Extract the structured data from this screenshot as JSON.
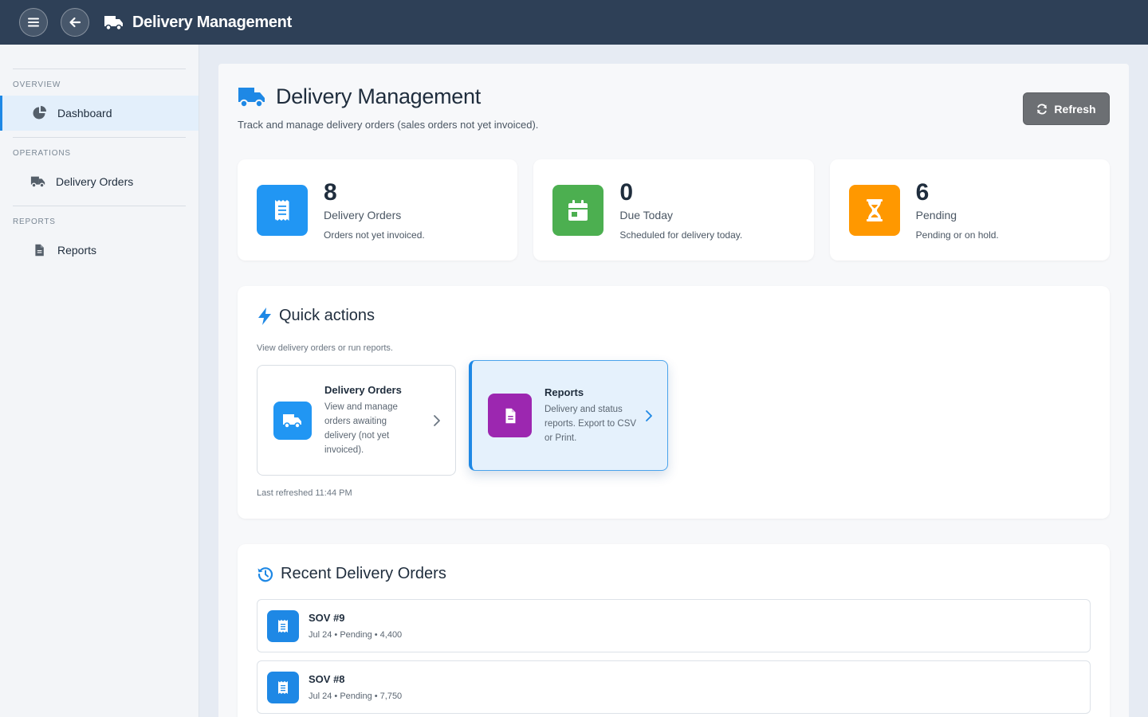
{
  "topbar": {
    "title": "Delivery Management"
  },
  "sidebar": {
    "sections": [
      {
        "heading": "OVERVIEW",
        "item": "Dashboard"
      },
      {
        "heading": "OPERATIONS",
        "item": "Delivery Orders"
      },
      {
        "heading": "REPORTS",
        "item": "Reports"
      }
    ]
  },
  "page": {
    "title": "Delivery Management",
    "subtitle": "Track and manage delivery orders (sales orders not yet invoiced).",
    "refresh_label": "Refresh"
  },
  "stats": [
    {
      "value": "8",
      "label": "Delivery Orders",
      "desc": "Orders not yet invoiced.",
      "color": "#2196f3",
      "icon": "receipt-icon"
    },
    {
      "value": "0",
      "label": "Due Today",
      "desc": "Scheduled for delivery today.",
      "color": "#4caf50",
      "icon": "calendar-icon"
    },
    {
      "value": "6",
      "label": "Pending",
      "desc": "Pending or on hold.",
      "color": "#ff9800",
      "icon": "hourglass-icon"
    }
  ],
  "quick_actions": {
    "title": "Quick actions",
    "subtitle": "View delivery orders or run reports.",
    "tiles": [
      {
        "name": "Delivery Orders",
        "desc": "View and manage orders awaiting delivery (not yet invoiced).",
        "color": "#2196f3",
        "icon": "truck-icon"
      },
      {
        "name": "Reports",
        "desc": "Delivery and status reports. Export to CSV or Print.",
        "color": "#9c27b0",
        "icon": "file-icon"
      }
    ],
    "footer": "Last refreshed 11:44 PM"
  },
  "recent": {
    "title": "Recent Delivery Orders",
    "orders": [
      {
        "title": "SOV #9",
        "meta": "Jul 24 • Pending • 4,400"
      },
      {
        "title": "SOV #8",
        "meta": "Jul 24 • Pending • 7,750"
      }
    ]
  },
  "colors": {
    "topbar": "#2e4057",
    "accent": "#1e88e5"
  }
}
